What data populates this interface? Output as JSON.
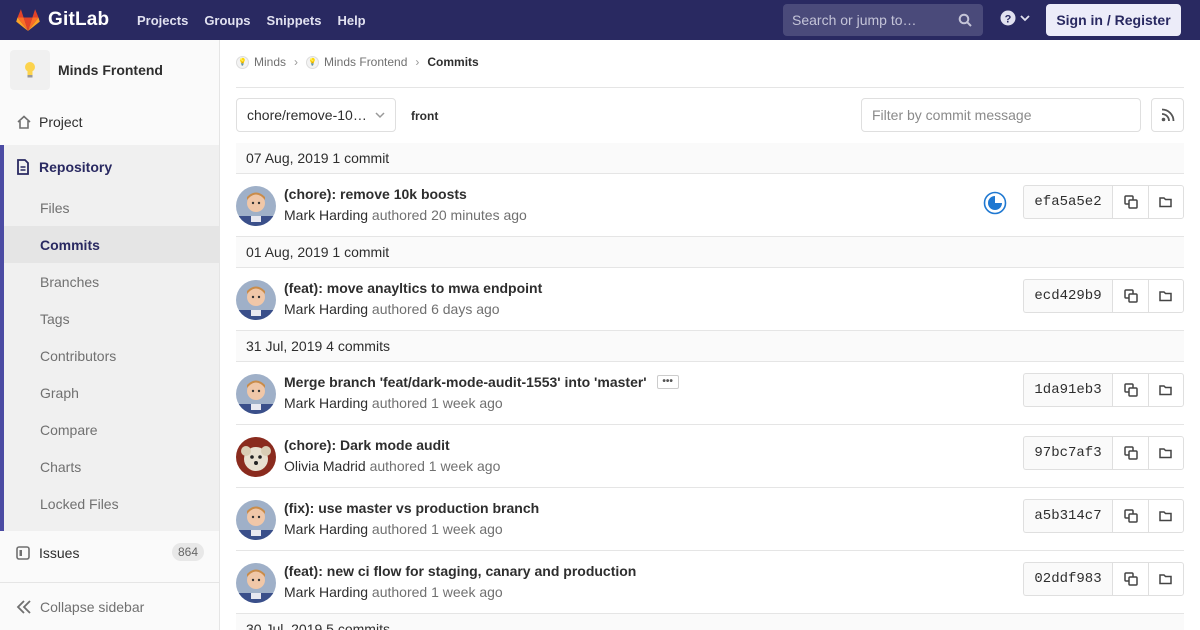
{
  "navbar": {
    "brand": "GitLab",
    "links": [
      "Projects",
      "Groups",
      "Snippets",
      "Help"
    ],
    "search_placeholder": "Search or jump to…",
    "sign_in": "Sign in / Register"
  },
  "sidebar": {
    "project_name": "Minds Frontend",
    "project_item": "Project",
    "repository": "Repository",
    "repo_items": [
      "Files",
      "Commits",
      "Branches",
      "Tags",
      "Contributors",
      "Graph",
      "Compare",
      "Charts",
      "Locked Files"
    ],
    "issues": "Issues",
    "issues_count": "864",
    "collapse": "Collapse sidebar"
  },
  "breadcrumb": {
    "group": "Minds",
    "project": "Minds Frontend",
    "current": "Commits"
  },
  "toolbar": {
    "branch": "chore/remove-10…",
    "path": "front",
    "filter_placeholder": "Filter by commit message"
  },
  "days": [
    {
      "header": "07 Aug, 2019 1 commit",
      "commits": [
        {
          "title": "(chore): remove 10k boosts",
          "author": "Mark Harding",
          "authored": "authored",
          "time": "20 minutes ago",
          "sha": "efa5a5e2",
          "pipeline": true
        }
      ]
    },
    {
      "header": "01 Aug, 2019 1 commit",
      "commits": [
        {
          "title": "(feat): move anayltics to mwa endpoint",
          "author": "Mark Harding",
          "authored": "authored",
          "time": "6 days ago",
          "sha": "ecd429b9"
        }
      ]
    },
    {
      "header": "31 Jul, 2019 4 commits",
      "commits": [
        {
          "title": "Merge branch 'feat/dark-mode-audit-1553' into 'master'",
          "author": "Mark Harding",
          "authored": "authored",
          "time": "1 week ago",
          "sha": "1da91eb3",
          "ellipsis": "•••"
        },
        {
          "title": "(chore): Dark mode audit",
          "author": "Olivia Madrid",
          "authored": "authored",
          "time": "1 week ago",
          "sha": "97bc7af3"
        },
        {
          "title": "(fix): use master vs production branch",
          "author": "Mark Harding",
          "authored": "authored",
          "time": "1 week ago",
          "sha": "a5b314c7"
        },
        {
          "title": "(feat): new ci flow for staging, canary and production",
          "author": "Mark Harding",
          "authored": "authored",
          "time": "1 week ago",
          "sha": "02ddf983"
        }
      ]
    },
    {
      "header": "30 Jul, 2019 5 commits",
      "commits": []
    }
  ],
  "colors": {
    "navbar": "#292961",
    "accent": "#4b4ba3",
    "pipeline_running": "#1f78d1"
  }
}
